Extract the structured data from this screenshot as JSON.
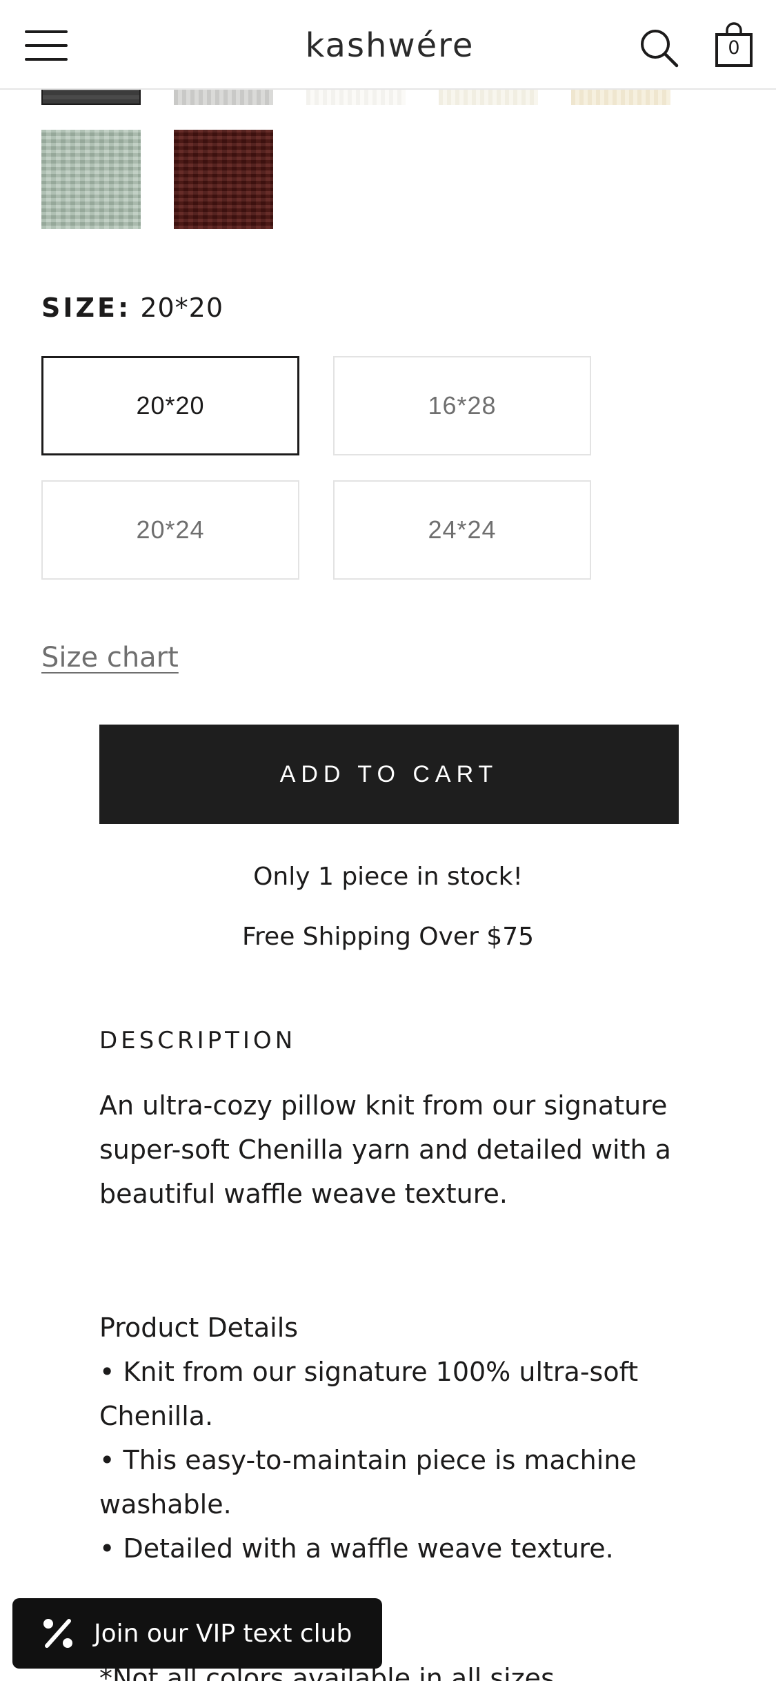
{
  "header": {
    "logo": "kashwére",
    "cart_count": "0",
    "icons": {
      "menu": "hamburger-menu-icon",
      "search": "search-icon",
      "cart": "shopping-bag-icon"
    }
  },
  "swatches": [
    "charcoal",
    "grey",
    "white",
    "ivory",
    "cream",
    "sage",
    "burgundy"
  ],
  "size": {
    "label": "SIZE:",
    "selected": "20*20",
    "options": [
      "20*20",
      "16*28",
      "20*24",
      "24*24"
    ],
    "size_chart_link": "Size chart"
  },
  "cart": {
    "add_label": "ADD TO CART",
    "stock_note": "Only 1 piece in stock!",
    "shipping_note": "Free Shipping Over $75"
  },
  "description": {
    "heading": "DESCRIPTION",
    "intro": "An ultra-cozy pillow knit from our signature super-soft Chenilla yarn and detailed with a beautiful waffle weave texture.",
    "details_heading": "Product Details",
    "bullets": [
      "• Knit from our signature 100% ultra-soft Chenilla.",
      "• This easy-to-maintain piece is machine washable.",
      "• Detailed with a waffle weave texture."
    ],
    "footnote": "*Not all colors available in all sizes"
  },
  "vip": {
    "label": "Join our VIP text club",
    "icon": "percent-icon"
  },
  "colors": {
    "button": "#1e1e1e",
    "text": "#1c1b1b",
    "muted": "#6f6f6f",
    "border": "#e3e3e3"
  }
}
